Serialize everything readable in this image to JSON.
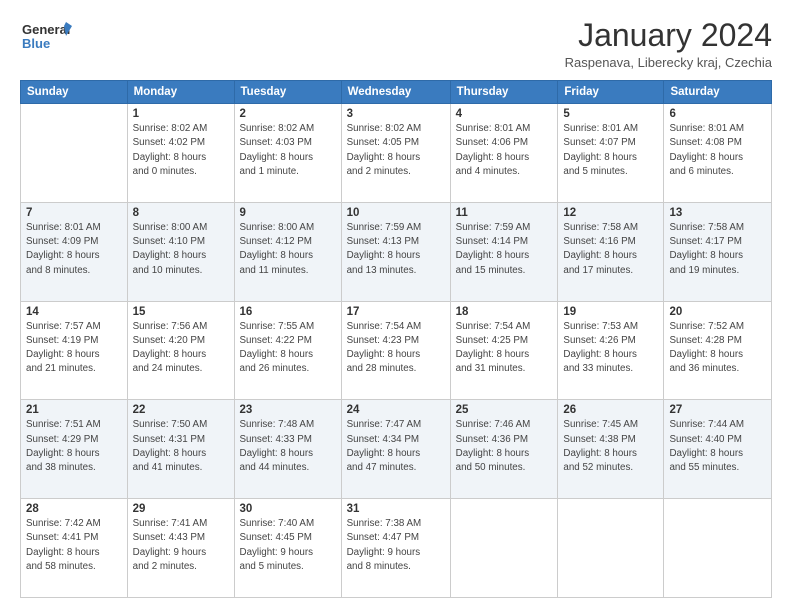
{
  "header": {
    "logo_line1": "General",
    "logo_line2": "Blue",
    "main_title": "January 2024",
    "subtitle": "Raspenava, Liberecky kraj, Czechia"
  },
  "calendar": {
    "days_of_week": [
      "Sunday",
      "Monday",
      "Tuesday",
      "Wednesday",
      "Thursday",
      "Friday",
      "Saturday"
    ],
    "weeks": [
      [
        {
          "day": "",
          "info": ""
        },
        {
          "day": "1",
          "info": "Sunrise: 8:02 AM\nSunset: 4:02 PM\nDaylight: 8 hours\nand 0 minutes."
        },
        {
          "day": "2",
          "info": "Sunrise: 8:02 AM\nSunset: 4:03 PM\nDaylight: 8 hours\nand 1 minute."
        },
        {
          "day": "3",
          "info": "Sunrise: 8:02 AM\nSunset: 4:05 PM\nDaylight: 8 hours\nand 2 minutes."
        },
        {
          "day": "4",
          "info": "Sunrise: 8:01 AM\nSunset: 4:06 PM\nDaylight: 8 hours\nand 4 minutes."
        },
        {
          "day": "5",
          "info": "Sunrise: 8:01 AM\nSunset: 4:07 PM\nDaylight: 8 hours\nand 5 minutes."
        },
        {
          "day": "6",
          "info": "Sunrise: 8:01 AM\nSunset: 4:08 PM\nDaylight: 8 hours\nand 6 minutes."
        }
      ],
      [
        {
          "day": "7",
          "info": "Sunrise: 8:01 AM\nSunset: 4:09 PM\nDaylight: 8 hours\nand 8 minutes."
        },
        {
          "day": "8",
          "info": "Sunrise: 8:00 AM\nSunset: 4:10 PM\nDaylight: 8 hours\nand 10 minutes."
        },
        {
          "day": "9",
          "info": "Sunrise: 8:00 AM\nSunset: 4:12 PM\nDaylight: 8 hours\nand 11 minutes."
        },
        {
          "day": "10",
          "info": "Sunrise: 7:59 AM\nSunset: 4:13 PM\nDaylight: 8 hours\nand 13 minutes."
        },
        {
          "day": "11",
          "info": "Sunrise: 7:59 AM\nSunset: 4:14 PM\nDaylight: 8 hours\nand 15 minutes."
        },
        {
          "day": "12",
          "info": "Sunrise: 7:58 AM\nSunset: 4:16 PM\nDaylight: 8 hours\nand 17 minutes."
        },
        {
          "day": "13",
          "info": "Sunrise: 7:58 AM\nSunset: 4:17 PM\nDaylight: 8 hours\nand 19 minutes."
        }
      ],
      [
        {
          "day": "14",
          "info": "Sunrise: 7:57 AM\nSunset: 4:19 PM\nDaylight: 8 hours\nand 21 minutes."
        },
        {
          "day": "15",
          "info": "Sunrise: 7:56 AM\nSunset: 4:20 PM\nDaylight: 8 hours\nand 24 minutes."
        },
        {
          "day": "16",
          "info": "Sunrise: 7:55 AM\nSunset: 4:22 PM\nDaylight: 8 hours\nand 26 minutes."
        },
        {
          "day": "17",
          "info": "Sunrise: 7:54 AM\nSunset: 4:23 PM\nDaylight: 8 hours\nand 28 minutes."
        },
        {
          "day": "18",
          "info": "Sunrise: 7:54 AM\nSunset: 4:25 PM\nDaylight: 8 hours\nand 31 minutes."
        },
        {
          "day": "19",
          "info": "Sunrise: 7:53 AM\nSunset: 4:26 PM\nDaylight: 8 hours\nand 33 minutes."
        },
        {
          "day": "20",
          "info": "Sunrise: 7:52 AM\nSunset: 4:28 PM\nDaylight: 8 hours\nand 36 minutes."
        }
      ],
      [
        {
          "day": "21",
          "info": "Sunrise: 7:51 AM\nSunset: 4:29 PM\nDaylight: 8 hours\nand 38 minutes."
        },
        {
          "day": "22",
          "info": "Sunrise: 7:50 AM\nSunset: 4:31 PM\nDaylight: 8 hours\nand 41 minutes."
        },
        {
          "day": "23",
          "info": "Sunrise: 7:48 AM\nSunset: 4:33 PM\nDaylight: 8 hours\nand 44 minutes."
        },
        {
          "day": "24",
          "info": "Sunrise: 7:47 AM\nSunset: 4:34 PM\nDaylight: 8 hours\nand 47 minutes."
        },
        {
          "day": "25",
          "info": "Sunrise: 7:46 AM\nSunset: 4:36 PM\nDaylight: 8 hours\nand 50 minutes."
        },
        {
          "day": "26",
          "info": "Sunrise: 7:45 AM\nSunset: 4:38 PM\nDaylight: 8 hours\nand 52 minutes."
        },
        {
          "day": "27",
          "info": "Sunrise: 7:44 AM\nSunset: 4:40 PM\nDaylight: 8 hours\nand 55 minutes."
        }
      ],
      [
        {
          "day": "28",
          "info": "Sunrise: 7:42 AM\nSunset: 4:41 PM\nDaylight: 8 hours\nand 58 minutes."
        },
        {
          "day": "29",
          "info": "Sunrise: 7:41 AM\nSunset: 4:43 PM\nDaylight: 9 hours\nand 2 minutes."
        },
        {
          "day": "30",
          "info": "Sunrise: 7:40 AM\nSunset: 4:45 PM\nDaylight: 9 hours\nand 5 minutes."
        },
        {
          "day": "31",
          "info": "Sunrise: 7:38 AM\nSunset: 4:47 PM\nDaylight: 9 hours\nand 8 minutes."
        },
        {
          "day": "",
          "info": ""
        },
        {
          "day": "",
          "info": ""
        },
        {
          "day": "",
          "info": ""
        }
      ]
    ]
  }
}
